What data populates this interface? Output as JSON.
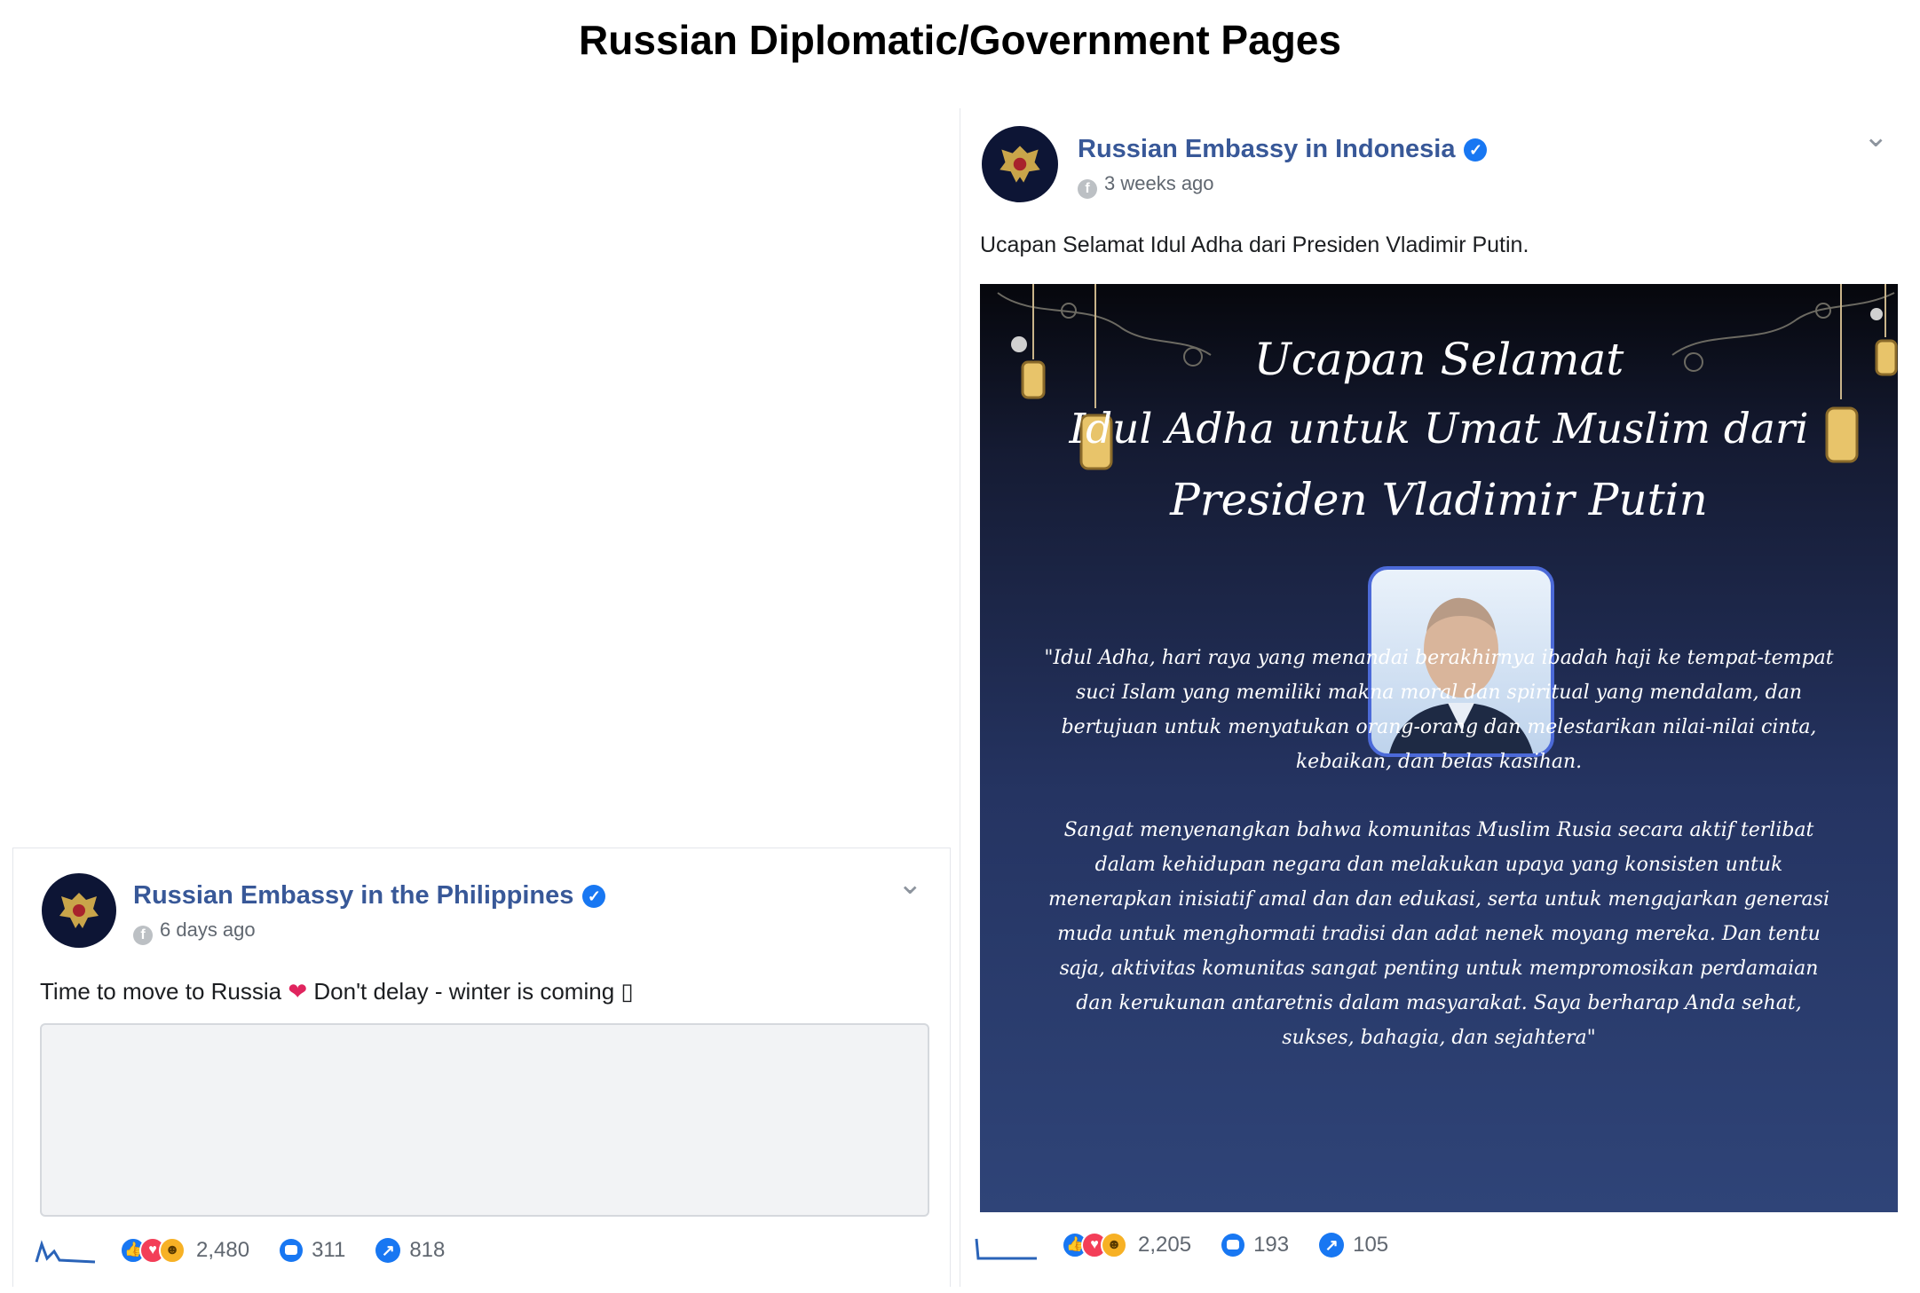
{
  "heading": "Russian Diplomatic/Government Pages",
  "posts": [
    {
      "page_name": "Russian Embassy in the Philippines",
      "time": "6 days ago",
      "text_before": "Time to move to Russia",
      "heart_icon": "❤",
      "text_after": "Don't delay - winter is coming ▯",
      "reactions": "2,480",
      "comments": "311",
      "shares": "818"
    },
    {
      "page_name": "Russian Embassy in Indonesia",
      "time": "3 weeks ago",
      "text": "Ucapan Selamat Idul Adha dari Presiden Vladimir Putin.",
      "image": {
        "title_lines": [
          "Ucapan Selamat",
          "Idul Adha untuk Umat Muslim dari",
          "Presiden Vladimir Putin"
        ],
        "quote_paragraph_1": "\"Idul Adha, hari raya yang menandai berakhirnya ibadah haji ke tempat-tempat suci Islam yang memiliki makna moral dan spiritual yang mendalam, dan bertujuan untuk menyatukan orang-orang dan melestarikan nilai-nilai cinta, kebaikan, dan belas kasihan.",
        "quote_paragraph_2": "Sangat menyenangkan bahwa komunitas Muslim Rusia secara aktif terlibat dalam kehidupan negara dan melakukan upaya yang konsisten untuk menerapkan inisiatif amal dan dan edukasi, serta untuk mengajarkan generasi muda untuk menghormati tradisi dan adat nenek moyang mereka. Dan tentu saja, aktivitas komunitas sangat penting untuk mempromosikan perdamaian dan kerukunan antaretnis dalam masyarakat. Saya berharap Anda sehat, sukses, bahagia, dan sejahtera\""
      },
      "reactions": "2,205",
      "comments": "193",
      "shares": "105"
    }
  ],
  "colors": {
    "page_name": "#385898",
    "verified": "#1877f2",
    "poster_bg": "#253462"
  },
  "icons": [
    "verified-badge-icon",
    "facebook-globe-icon",
    "chevron-down-icon",
    "like-icon",
    "love-icon",
    "haha-icon",
    "comment-icon",
    "share-icon",
    "sparkline-icon"
  ]
}
